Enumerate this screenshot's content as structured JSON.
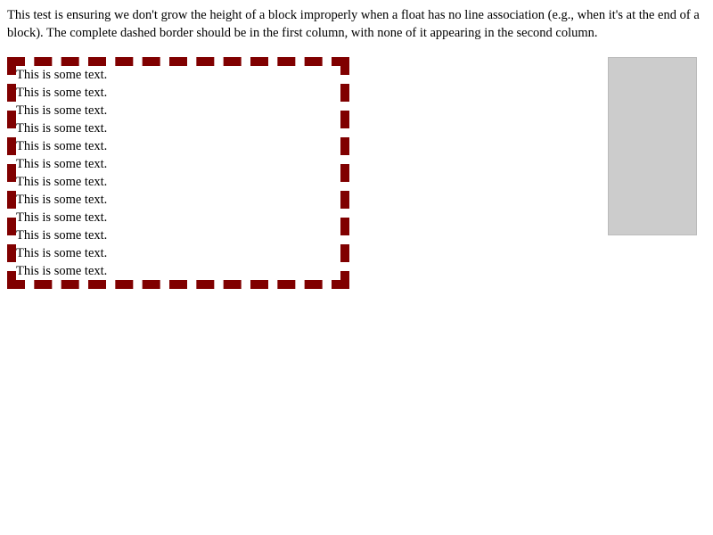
{
  "intro_text": "This test is ensuring we don't grow the height of a block improperly when a float has no line association (e.g., when it's at the end of a block). The complete dashed border should be in the first column, with none of it appearing in the second column.",
  "lines": [
    "This is some text.",
    "This is some text.",
    "This is some text.",
    "This is some text.",
    "This is some text.",
    "This is some text.",
    "This is some text.",
    "This is some text.",
    "This is some text.",
    "This is some text.",
    "This is some text.",
    "This is some text."
  ],
  "colors": {
    "border": "#800000",
    "float_fill": "#cccccc"
  }
}
